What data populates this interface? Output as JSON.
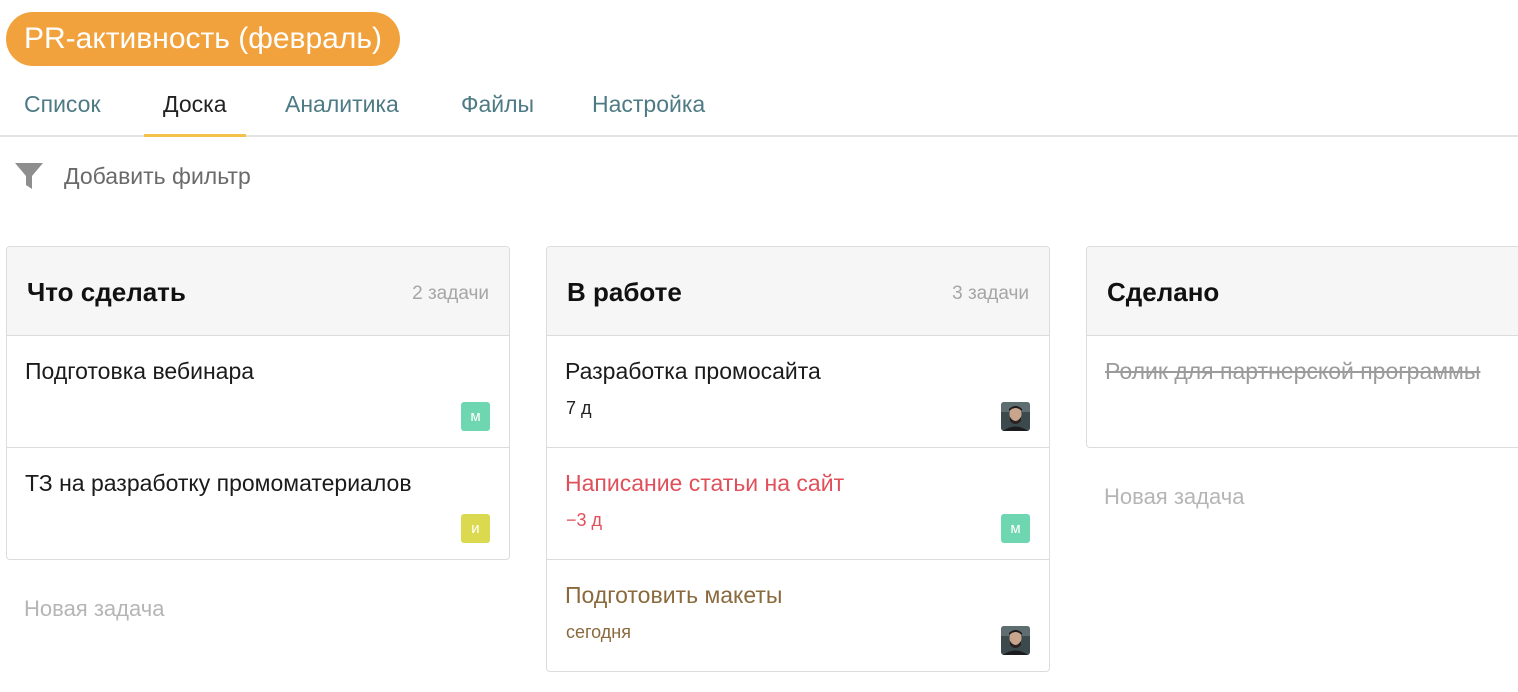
{
  "project": {
    "title": "PR-активность (февраль)",
    "accent_color": "#f2a23d"
  },
  "tabs": [
    {
      "label": "Список",
      "active": false
    },
    {
      "label": "Доска",
      "active": true
    },
    {
      "label": "Аналитика",
      "active": false
    },
    {
      "label": "Файлы",
      "active": false
    },
    {
      "label": "Настройка",
      "active": false
    }
  ],
  "filter": {
    "icon": "funnel-icon",
    "label": "Добавить фильтр"
  },
  "columns": [
    {
      "title": "Что сделать",
      "count": "2 задачи",
      "new_task": "Новая задача",
      "cards": [
        {
          "title": "Подготовка вебинара",
          "due": "",
          "status": "normal",
          "assignee": {
            "type": "letter",
            "letter": "м",
            "color": "#6fd6b2"
          }
        },
        {
          "title": "ТЗ на разработку промоматериалов",
          "due": "",
          "status": "normal",
          "assignee": {
            "type": "letter",
            "letter": "и",
            "color": "#dbd94f"
          }
        }
      ]
    },
    {
      "title": "В работе",
      "count": "3 задачи",
      "new_task": "",
      "cards": [
        {
          "title": "Разработка промосайта",
          "due": "7 д",
          "status": "normal",
          "assignee": {
            "type": "photo",
            "icon": "user-photo-icon"
          }
        },
        {
          "title": "Написание статьи на сайт",
          "due": "−3 д",
          "status": "overdue",
          "assignee": {
            "type": "letter",
            "letter": "м",
            "color": "#6fd6b2"
          }
        },
        {
          "title": "Подготовить макеты",
          "due": "сегодня",
          "status": "today",
          "assignee": {
            "type": "photo",
            "icon": "user-photo-icon"
          }
        }
      ]
    },
    {
      "title": "Сделано",
      "count": "",
      "new_task": "Новая задача",
      "cards": [
        {
          "title": "Ролик для партнерской программы",
          "due": "",
          "status": "done",
          "assignee": null
        }
      ]
    }
  ]
}
